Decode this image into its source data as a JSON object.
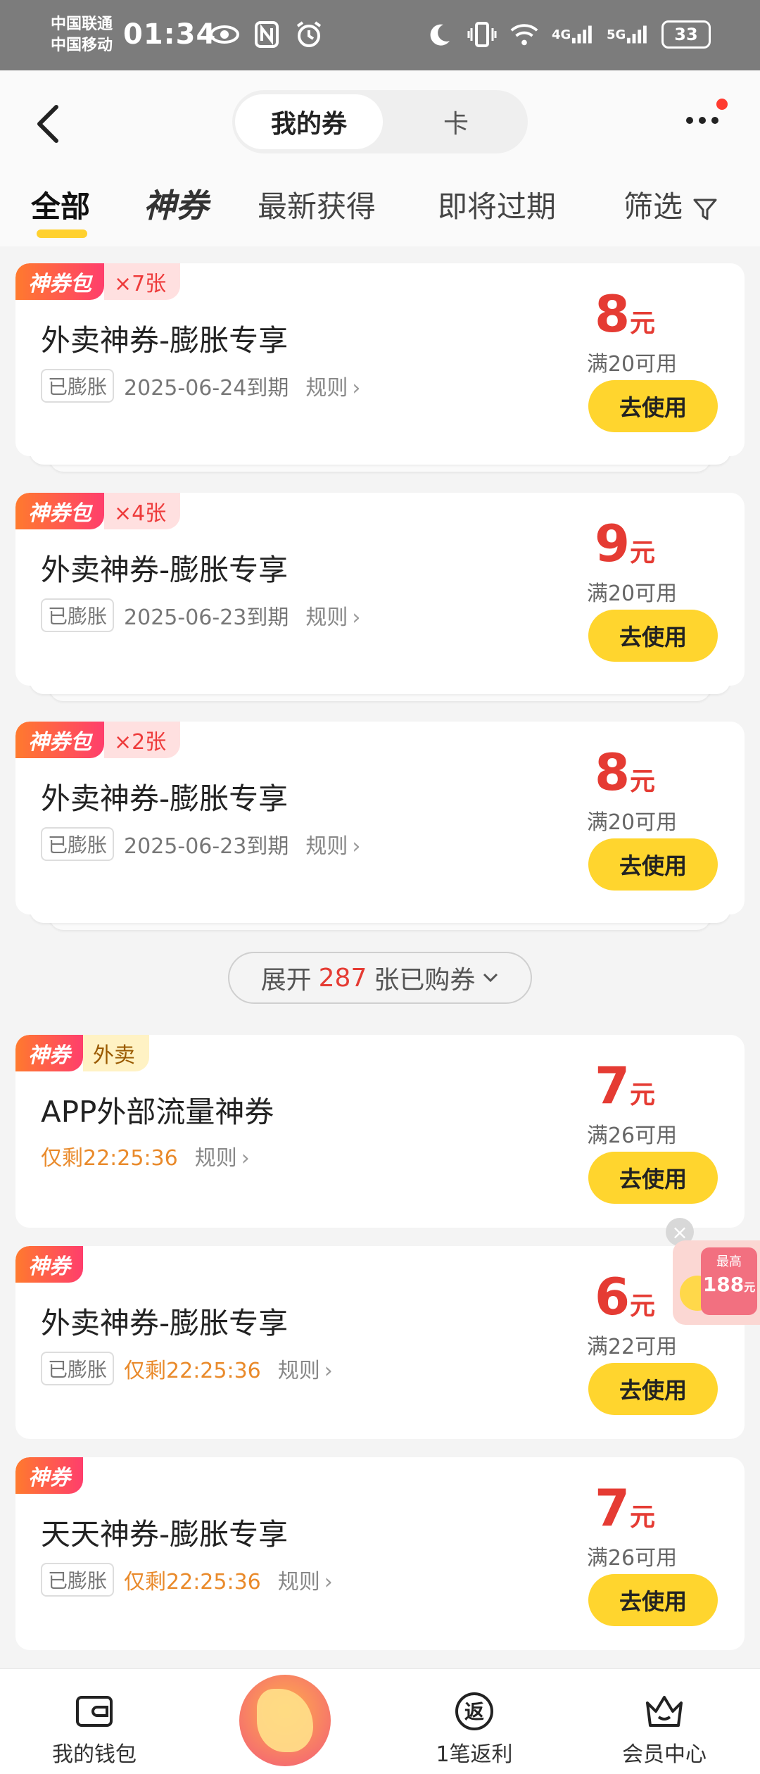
{
  "status_bar": {
    "carrier1": "中国联通",
    "carrier2": "中国移动",
    "time": "01:34",
    "net1": "4G",
    "net2": "5G",
    "battery": "33"
  },
  "header": {
    "seg_active": "我的券",
    "seg_inactive": "卡"
  },
  "tabs": [
    {
      "label": "全部"
    },
    {
      "label": "神券"
    },
    {
      "label": "最新获得"
    },
    {
      "label": "即将过期"
    },
    {
      "label": "筛选"
    }
  ],
  "coupons": [
    {
      "badge": "神券包",
      "count": "×7张",
      "title": "外卖神券-膨胀专享",
      "pill": "已膨胀",
      "expiry": "2025-06-24到期",
      "rules": "规则",
      "price": "8",
      "unit": "元",
      "cond": "满20可用",
      "btn": "去使用"
    },
    {
      "badge": "神券包",
      "count": "×4张",
      "title": "外卖神券-膨胀专享",
      "pill": "已膨胀",
      "expiry": "2025-06-23到期",
      "rules": "规则",
      "price": "9",
      "unit": "元",
      "cond": "满20可用",
      "btn": "去使用"
    },
    {
      "badge": "神券包",
      "count": "×2张",
      "title": "外卖神券-膨胀专享",
      "pill": "已膨胀",
      "expiry": "2025-06-23到期",
      "rules": "规则",
      "price": "8",
      "unit": "元",
      "cond": "满20可用",
      "btn": "去使用"
    },
    {
      "badge": "神券",
      "tag": "外卖",
      "title": "APP外部流量神券",
      "countdown": "仅剩22:25:36",
      "rules": "规则",
      "price": "7",
      "unit": "元",
      "cond": "满26可用",
      "btn": "去使用"
    },
    {
      "badge": "神券",
      "title": "外卖神券-膨胀专享",
      "pill": "已膨胀",
      "countdown": "仅剩22:25:36",
      "rules": "规则",
      "price": "6",
      "unit": "元",
      "cond": "满22可用",
      "btn": "去使用"
    },
    {
      "badge": "神券",
      "title": "天天神券-膨胀专享",
      "pill": "已膨胀",
      "countdown": "仅剩22:25:36",
      "rules": "规则",
      "price": "7",
      "unit": "元",
      "cond": "满26可用",
      "btn": "去使用"
    }
  ],
  "expand": {
    "prefix": "展开",
    "count": "287",
    "suffix": "张已购券"
  },
  "float_widget": {
    "top": "最高",
    "amount": "188",
    "unit": "元"
  },
  "bottom_nav": [
    {
      "label": "我的钱包",
      "icon": "wallet-icon"
    },
    {
      "label": "",
      "icon": "center-promo-icon"
    },
    {
      "label": "1笔返利",
      "icon": "rebate-icon",
      "glyph": "返"
    },
    {
      "label": "会员中心",
      "icon": "crown-icon"
    }
  ],
  "colors": {
    "accent_yellow": "#ffd52e",
    "price_red": "#e53b33",
    "countdown_orange": "#e98a2b"
  }
}
